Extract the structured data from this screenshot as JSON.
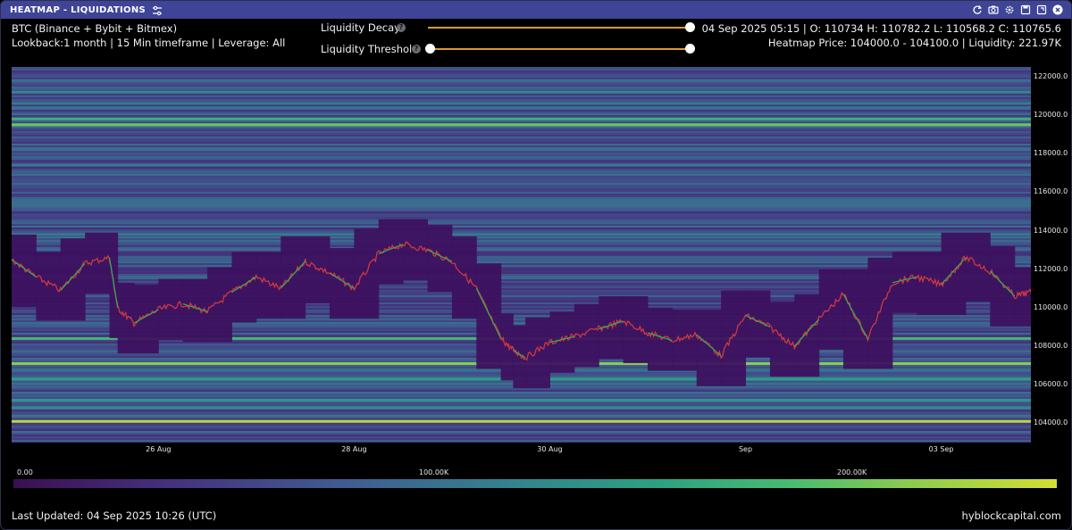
{
  "window": {
    "title": "HEATMAP - LIQUIDATIONS",
    "icons": [
      "settings-sliders-icon",
      "refresh-icon",
      "camera-icon",
      "gear-icon",
      "save-icon",
      "expand-icon",
      "close-icon"
    ]
  },
  "info": {
    "symbol": "BTC (Binance + Bybit + Bitmex)",
    "settings": "Lookback:1 month | 15 Min timeframe | Leverage: All",
    "ohlc": "04 Sep 2025 05:15 | O: 110734 H: 110782.2 L: 110568.2 C: 110765.6",
    "heatmap_price": "Heatmap Price: 104000.0 - 104100.0 | Liquidity: 221.97K"
  },
  "controls": {
    "decay_label": "Liquidity Decay",
    "threshold_label": "Liquidity Threshold",
    "decay_value": 1.0,
    "threshold_value": 0.0
  },
  "chart_data": {
    "type": "heatmap",
    "y_axis": {
      "ticks": [
        "122000.0",
        "120000.0",
        "118000.0",
        "116000.0",
        "114000.0",
        "112000.0",
        "110000.0",
        "108000.0",
        "106000.0",
        "104000.0"
      ],
      "range": [
        103000,
        122500
      ]
    },
    "x_axis": {
      "ticks": [
        "26 Aug",
        "28 Aug",
        "30 Aug",
        "Sep",
        "03 Sep"
      ]
    },
    "colorbar": {
      "labels": [
        "0.00",
        "100.00K",
        "200.00K"
      ],
      "range": [
        0,
        221970
      ]
    },
    "price_series": [
      [
        "25 Aug 00:00",
        112500
      ],
      [
        "25 Aug 06:00",
        111600
      ],
      [
        "25 Aug 12:00",
        110900
      ],
      [
        "25 Aug 18:00",
        112300
      ],
      [
        "26 Aug 00:00",
        112600
      ],
      [
        "26 Aug 02:00",
        110000
      ],
      [
        "26 Aug 06:00",
        109200
      ],
      [
        "26 Aug 12:00",
        109900
      ],
      [
        "26 Aug 18:00",
        110200
      ],
      [
        "27 Aug 00:00",
        109800
      ],
      [
        "27 Aug 06:00",
        110800
      ],
      [
        "27 Aug 12:00",
        111600
      ],
      [
        "27 Aug 18:00",
        111000
      ],
      [
        "28 Aug 00:00",
        112400
      ],
      [
        "28 Aug 06:00",
        111800
      ],
      [
        "28 Aug 12:00",
        111000
      ],
      [
        "28 Aug 18:00",
        112800
      ],
      [
        "29 Aug 00:00",
        113300
      ],
      [
        "29 Aug 06:00",
        113000
      ],
      [
        "29 Aug 12:00",
        112400
      ],
      [
        "29 Aug 18:00",
        111000
      ],
      [
        "30 Aug 00:00",
        108400
      ],
      [
        "30 Aug 03:00",
        107800
      ],
      [
        "30 Aug 06:00",
        107400
      ],
      [
        "30 Aug 12:00",
        108200
      ],
      [
        "30 Aug 18:00",
        108500
      ],
      [
        "31 Aug 00:00",
        108900
      ],
      [
        "31 Aug 06:00",
        109300
      ],
      [
        "31 Aug 12:00",
        108700
      ],
      [
        "31 Aug 18:00",
        108300
      ],
      [
        "01 Sep 00:00",
        108600
      ],
      [
        "01 Sep 06:00",
        107500
      ],
      [
        "01 Sep 12:00",
        109600
      ],
      [
        "01 Sep 18:00",
        109000
      ],
      [
        "02 Sep 00:00",
        108000
      ],
      [
        "02 Sep 06:00",
        109400
      ],
      [
        "02 Sep 12:00",
        110700
      ],
      [
        "02 Sep 18:00",
        108400
      ],
      [
        "03 Sep 00:00",
        111300
      ],
      [
        "03 Sep 06:00",
        111600
      ],
      [
        "03 Sep 12:00",
        111200
      ],
      [
        "03 Sep 18:00",
        112600
      ],
      [
        "04 Sep 00:00",
        111900
      ],
      [
        "04 Sep 06:00",
        110600
      ],
      [
        "04 Sep 10:00",
        110800
      ]
    ],
    "bands": [
      {
        "price": 121800,
        "intensity": 0.35
      },
      {
        "price": 121200,
        "intensity": 0.45
      },
      {
        "price": 120600,
        "intensity": 0.4
      },
      {
        "price": 119800,
        "intensity": 0.65
      },
      {
        "price": 119500,
        "intensity": 0.8
      },
      {
        "price": 118200,
        "intensity": 0.35
      },
      {
        "price": 117400,
        "intensity": 0.4
      },
      {
        "price": 115300,
        "intensity": 0.35
      },
      {
        "price": 113800,
        "intensity": 0.4
      },
      {
        "price": 108400,
        "intensity": 0.7
      },
      {
        "price": 107100,
        "intensity": 0.85
      },
      {
        "price": 106300,
        "intensity": 0.55
      },
      {
        "price": 105200,
        "intensity": 0.5
      },
      {
        "price": 104800,
        "intensity": 0.45
      },
      {
        "price": 104100,
        "intensity": 0.95
      }
    ]
  },
  "footer": {
    "last_updated": "Last Updated: 04 Sep 2025 10:26 (UTC)",
    "brand": "hyblockcapital.com"
  }
}
